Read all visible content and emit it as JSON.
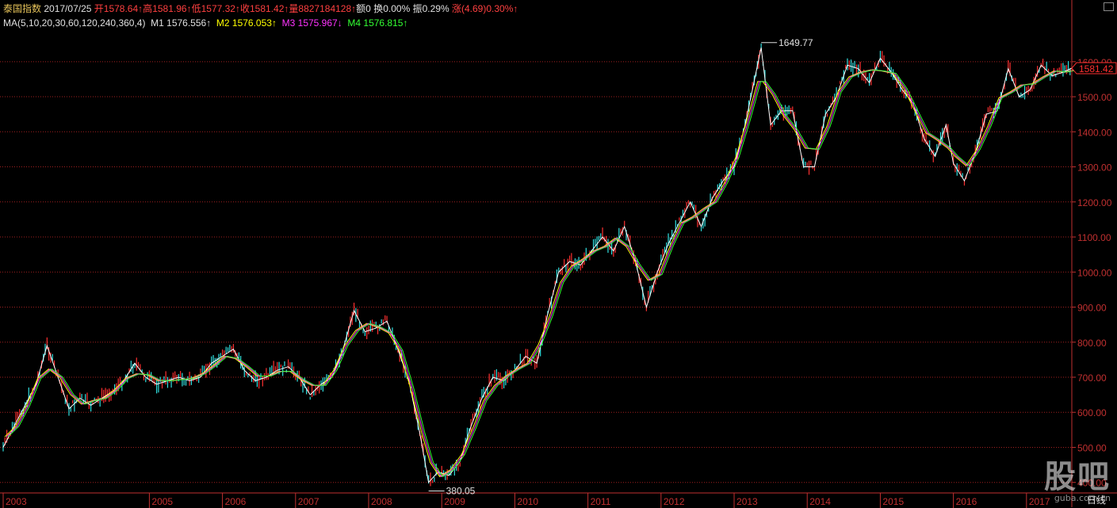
{
  "header": {
    "name": "泰国指数",
    "date": "2017/07/25",
    "open_label": "开",
    "open": "1578.64↑",
    "high_label": "高",
    "high": "1581.96↑",
    "low_label": "低",
    "low": "1577.32↑",
    "close_label": "收",
    "close": "1581.42↑",
    "volume_label": "量",
    "volume": "8827184128↑",
    "amount_label": "额",
    "amount": "0",
    "turnover_label": "换",
    "turnover": "0.00%",
    "amplitude_label": "振",
    "amplitude": "0.29%",
    "change_label": "涨",
    "change": "(4.69)0.30%↑"
  },
  "ma_line": {
    "params": "MA(5,10,20,30,60,120,240,360,4)",
    "m1_label": "M1",
    "m1": "1576.556↑",
    "m2_label": "M2",
    "m2": "1576.053↑",
    "m3_label": "M3",
    "m3": "1575.967↓",
    "m4_label": "M4",
    "m4": "1576.815↑"
  },
  "current_price_tag": "1581.42",
  "period_label": "日线",
  "watermark": {
    "main": "股吧",
    "sub": "guba.com.cn"
  },
  "colors": {
    "background": "#000000",
    "axis": "#c03030",
    "grid": "#a02020",
    "up": "#ff3030",
    "down": "#30e0e0",
    "ma1": "#ffffff",
    "ma2": "#ffff00",
    "ma3": "#ff33ff",
    "ma4": "#33ff33"
  },
  "chart_data": {
    "type": "line",
    "title": "",
    "xlabel": "",
    "ylabel": "",
    "ylim": [
      370,
      1690
    ],
    "y_ticks": [
      400,
      500,
      600,
      700,
      800,
      900,
      1000,
      1100,
      1200,
      1300,
      1400,
      1500,
      1600
    ],
    "y_tick_labels": [
      "400.00",
      "500.00",
      "600.00",
      "700.00",
      "800.00",
      "900.00",
      "1000.00",
      "1100.00",
      "1200.00",
      "1300.00",
      "1400.00",
      "1500.00",
      "1600.00"
    ],
    "x_labels": [
      "2003",
      "2005",
      "2006",
      "2007",
      "2008",
      "2009",
      "2010",
      "2011",
      "2012",
      "2013",
      "2014",
      "2015",
      "2016",
      "2017"
    ],
    "x_label_dates": [
      2003.0,
      2005.0,
      2006.0,
      2007.0,
      2008.0,
      2009.0,
      2010.0,
      2011.0,
      2012.0,
      2013.0,
      2014.0,
      2015.0,
      2016.0,
      2017.0
    ],
    "xlim": [
      2003.0,
      2017.62
    ],
    "annotations": [
      {
        "text": "1649.77",
        "x": 2013.37,
        "y": 1649.77
      },
      {
        "text": "380.05",
        "x": 2008.82,
        "y": 380.05
      }
    ],
    "series": [
      {
        "name": "泰国指数",
        "x": [
          2003.0,
          2003.15,
          2003.3,
          2003.45,
          2003.6,
          2003.75,
          2003.9,
          2004.05,
          2004.2,
          2004.35,
          2004.5,
          2004.65,
          2004.8,
          2004.95,
          2005.1,
          2005.25,
          2005.4,
          2005.55,
          2005.7,
          2005.85,
          2006.0,
          2006.15,
          2006.3,
          2006.45,
          2006.6,
          2006.75,
          2006.9,
          2007.05,
          2007.2,
          2007.35,
          2007.5,
          2007.65,
          2007.8,
          2007.95,
          2008.1,
          2008.25,
          2008.4,
          2008.55,
          2008.7,
          2008.82,
          2008.95,
          2009.1,
          2009.25,
          2009.4,
          2009.55,
          2009.7,
          2009.85,
          2010.0,
          2010.15,
          2010.3,
          2010.45,
          2010.6,
          2010.75,
          2010.9,
          2011.05,
          2011.2,
          2011.35,
          2011.5,
          2011.65,
          2011.8,
          2011.95,
          2012.1,
          2012.25,
          2012.4,
          2012.55,
          2012.7,
          2012.85,
          2013.0,
          2013.15,
          2013.3,
          2013.37,
          2013.5,
          2013.65,
          2013.8,
          2013.95,
          2014.1,
          2014.25,
          2014.4,
          2014.55,
          2014.7,
          2014.85,
          2015.0,
          2015.15,
          2015.3,
          2015.45,
          2015.6,
          2015.75,
          2015.9,
          2016.0,
          2016.15,
          2016.3,
          2016.45,
          2016.6,
          2016.75,
          2016.9,
          2017.05,
          2017.2,
          2017.35,
          2017.5,
          2017.62
        ],
        "y": [
          500,
          560,
          620,
          680,
          790,
          700,
          610,
          640,
          620,
          640,
          660,
          690,
          740,
          700,
          680,
          690,
          700,
          690,
          700,
          740,
          760,
          780,
          720,
          690,
          700,
          720,
          730,
          700,
          650,
          680,
          700,
          780,
          890,
          830,
          840,
          860,
          780,
          690,
          540,
          400,
          430,
          420,
          460,
          560,
          640,
          700,
          690,
          720,
          760,
          740,
          880,
          1000,
          1030,
          1020,
          1060,
          1100,
          1060,
          1130,
          1030,
          900,
          1000,
          1080,
          1140,
          1200,
          1130,
          1210,
          1260,
          1300,
          1420,
          1570,
          1640,
          1420,
          1460,
          1460,
          1300,
          1300,
          1450,
          1500,
          1590,
          1580,
          1540,
          1610,
          1570,
          1520,
          1480,
          1380,
          1330,
          1420,
          1310,
          1260,
          1340,
          1450,
          1460,
          1580,
          1500,
          1520,
          1590,
          1560,
          1570,
          1581.42
        ]
      }
    ]
  }
}
